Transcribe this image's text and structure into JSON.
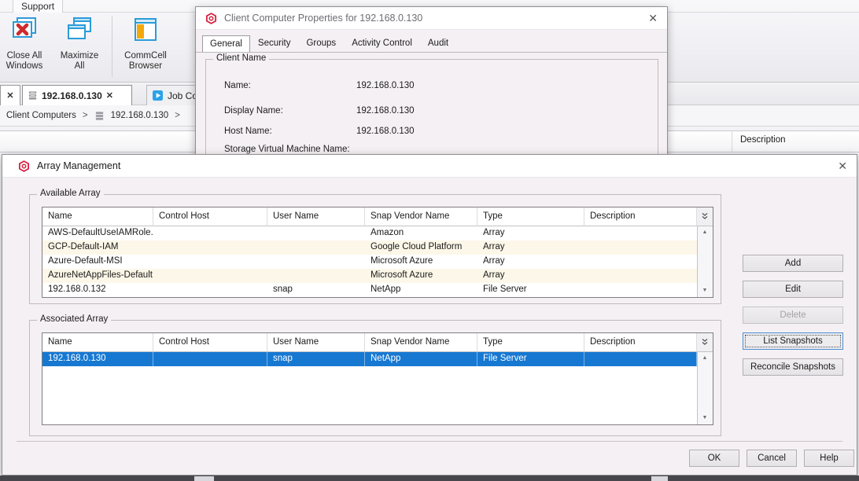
{
  "glyphs": {
    "close": "✕",
    "arrow_up": "▲",
    "arrow_down": "▼"
  },
  "colors": {
    "selection_blue": "#1778d2",
    "commvault_red": "#d6203f",
    "row_alt_cream": "#fcf7e8",
    "focus_blue": "#4b8fd6",
    "icon_blue": "#2b9cd8",
    "icon_yellow": "#f5a80c"
  },
  "ribbon": {
    "tab_label": "Support",
    "buttons": [
      {
        "line1": "Close All",
        "line2": "Windows",
        "icon": "close-all-windows-icon"
      },
      {
        "line1": "Maximize",
        "line2": "All",
        "icon": "maximize-all-icon"
      },
      {
        "line1": "CommCell",
        "line2": "Browser",
        "icon": "commcell-browser-icon"
      }
    ]
  },
  "window_tabs": {
    "active_tab": {
      "label": "192.168.0.130"
    },
    "job_tab": {
      "label": "Job Controller"
    }
  },
  "breadcrumb": {
    "items": [
      "Client Computers",
      "192.168.0.130"
    ],
    "separator": ">"
  },
  "content_header": {
    "description": "Description"
  },
  "properties_dialog": {
    "title": "Client Computer Properties for 192.168.0.130",
    "tabs": [
      "General",
      "Security",
      "Groups",
      "Activity Control",
      "Audit"
    ],
    "active_tab": "General",
    "group_title": "Client Name",
    "fields": [
      {
        "label": "Name:",
        "value": "192.168.0.130"
      },
      {
        "label": "Display Name:",
        "value": "192.168.0.130"
      },
      {
        "label": "Host Name:",
        "value": "192.168.0.130"
      },
      {
        "label": "Storage Virtual Machine Name:",
        "value": ""
      }
    ]
  },
  "array_dialog": {
    "title": "Array Management",
    "available": {
      "group_title": "Available Array",
      "columns": [
        "Name",
        "Control Host",
        "User Name",
        "Snap Vendor Name",
        "Type",
        "Description"
      ],
      "rows": [
        [
          "AWS-DefaultUseIAMRole...",
          "",
          "",
          "Amazon",
          "Array",
          ""
        ],
        [
          "GCP-Default-IAM",
          "",
          "",
          "Google Cloud Platform",
          "Array",
          ""
        ],
        [
          "Azure-Default-MSI",
          "",
          "",
          "Microsoft Azure",
          "Array",
          ""
        ],
        [
          "AzureNetAppFiles-Default...",
          "",
          "",
          "Microsoft Azure",
          "Array",
          ""
        ],
        [
          "192.168.0.132",
          "",
          "snap",
          "NetApp",
          "File Server",
          ""
        ]
      ]
    },
    "associated": {
      "group_title": "Associated Array",
      "columns": [
        "Name",
        "Control Host",
        "User Name",
        "Snap Vendor Name",
        "Type",
        "Description"
      ],
      "rows": [
        [
          "192.168.0.130",
          "",
          "snap",
          "NetApp",
          "File Server",
          ""
        ]
      ],
      "selected_row": 0
    },
    "side_buttons": [
      {
        "label": "Add",
        "state": "enabled"
      },
      {
        "label": "Edit",
        "state": "enabled"
      },
      {
        "label": "Delete",
        "state": "disabled"
      },
      {
        "label": "List Snapshots",
        "state": "focused"
      },
      {
        "label": "Reconcile Snapshots",
        "state": "enabled"
      }
    ],
    "footer_buttons": [
      "OK",
      "Cancel",
      "Help"
    ]
  }
}
